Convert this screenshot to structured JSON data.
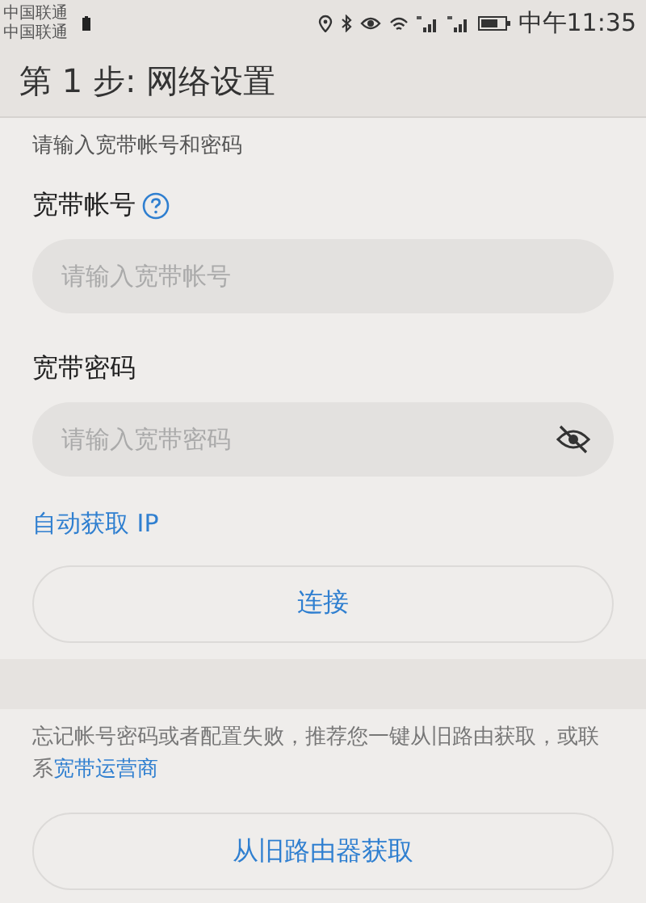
{
  "status_bar": {
    "carriers": [
      "中国联通",
      "中国联通"
    ],
    "time": "中午11:35"
  },
  "title": "第 1 步: 网络设置",
  "section_hint": "请输入宽带帐号和密码",
  "fields": [
    {
      "kind": "text",
      "label": "宽带帐号",
      "help": true,
      "placeholder": "请输入宽带帐号"
    },
    {
      "kind": "password",
      "label": "宽带密码",
      "help": false,
      "placeholder": "请输入宽带密码"
    }
  ],
  "auto_ip_link": "自动获取 IP",
  "connect_button": "连接",
  "footer": {
    "text": "忘记帐号密码或者配置失败，推荐您一键从旧路由获取，或联系",
    "link": "宽带运营商"
  },
  "footer_button": "从旧路由器获取"
}
